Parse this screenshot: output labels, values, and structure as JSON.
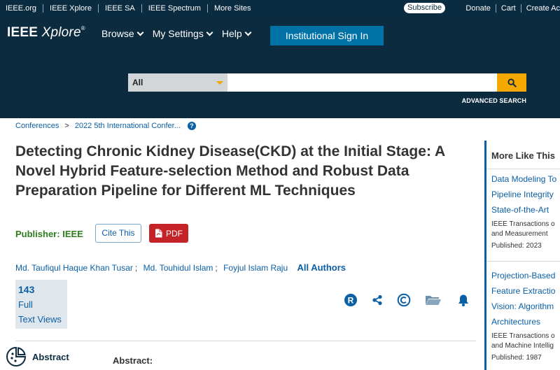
{
  "topbar": {
    "links": [
      "IEEE.org",
      "IEEE Xplore",
      "IEEE SA",
      "IEEE Spectrum",
      "More Sites"
    ],
    "subscribe": "Subscribe",
    "right": [
      "Donate",
      "Cart",
      "Create Ac"
    ]
  },
  "header": {
    "logo_main": "IEEE",
    "logo_italic": "Xplore",
    "logo_mark": "®",
    "nav": [
      "Browse",
      "My Settings",
      "Help"
    ],
    "signin": "Institutional Sign In",
    "search_scope": "All",
    "search_value": "",
    "advanced": "ADVANCED SEARCH"
  },
  "breadcrumb": [
    "Conferences",
    "2022 5th International Confer..."
  ],
  "breadcrumb_sep": ">",
  "breadcrumb_help": "?",
  "article": {
    "title": "Detecting Chronic Kidney Disease(CKD) at the Initial Stage: A Novel Hybrid Feature-selection Method and Robust Data Preparation Pipeline for Different ML Techniques",
    "publisher_label": "Publisher:",
    "publisher": "IEEE",
    "cite_label": "Cite This",
    "pdf_label": "PDF",
    "authors": [
      "Md. Taufiqul Haque Khan Tusar",
      "Md. Touhidul Islam",
      "Foyjul Islam Raju"
    ],
    "author_sep": ";",
    "all_authors": "All Authors",
    "metric_count": "143",
    "metric_line1": "Full",
    "metric_line2": "Text Views",
    "abstract_nav": "Abstract",
    "abstract_heading": "Abstract:"
  },
  "actions": [
    "rights-icon",
    "share-icon",
    "copyright-icon",
    "folder-icon",
    "alert-icon"
  ],
  "side": {
    "heading": "More Like This",
    "items": [
      {
        "title_lines": [
          "Data Modeling To",
          "Pipeline Integrity",
          "State-of-the-Art"
        ],
        "pub_lines": [
          "IEEE Transactions o",
          "and Measurement"
        ],
        "date": "Published: 2023"
      },
      {
        "title_lines": [
          "Projection-Based",
          "Feature Extractio",
          "Vision: Algorithm",
          "Architectures"
        ],
        "pub_lines": [
          "IEEE Transactions o",
          "and Machine Intellig"
        ],
        "date": "Published: 1987"
      }
    ]
  },
  "colors": {
    "header_bg": "#0c2b3f",
    "accent_blue": "#0072a6",
    "link_blue": "#0b5fa5",
    "search_button": "#f5a800",
    "pdf_red": "#c42428",
    "publisher_green": "#2d7d1d"
  }
}
